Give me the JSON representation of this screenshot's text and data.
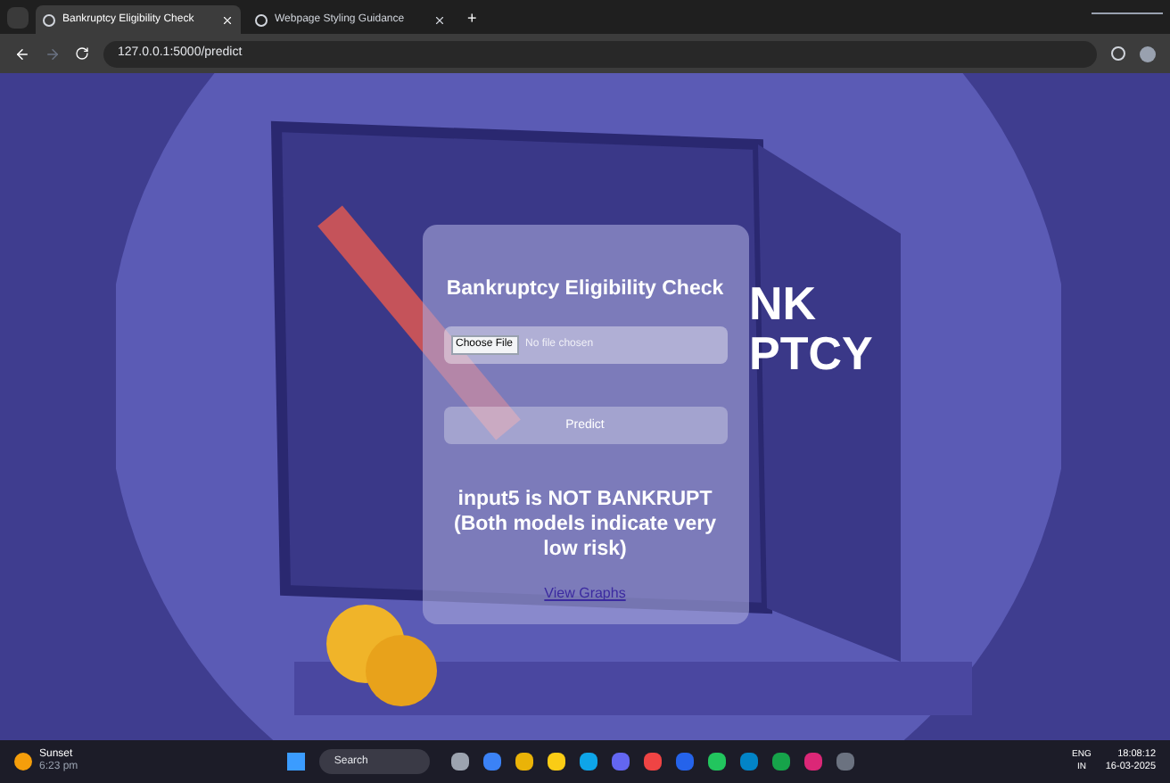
{
  "browser": {
    "tabs": [
      {
        "title": "Bankruptcy Eligibility Check",
        "selected": true
      },
      {
        "title": "Webpage Styling Guidance",
        "selected": false
      }
    ],
    "new_tab": "+",
    "address": "127.0.0.1:5000/predict"
  },
  "illustration": {
    "sign_lines": [
      "NK",
      "PTCY"
    ]
  },
  "card": {
    "title": "Bankruptcy Eligibility Check",
    "file_button": "Choose File",
    "file_status": "No file chosen",
    "predict_button": "Predict",
    "result": "input5 is NOT BANKRUPT (Both models indicate very low risk)",
    "link": "View Graphs"
  },
  "taskbar": {
    "weather": {
      "title": "Sunset",
      "time": "6:23 pm"
    },
    "search": "Search",
    "apps": [
      {
        "color": "#9ca3af"
      },
      {
        "color": "#3b82f6"
      },
      {
        "color": "#eab308"
      },
      {
        "color": "#facc15"
      },
      {
        "color": "#0ea5e9"
      },
      {
        "color": "#6366f1"
      },
      {
        "color": "#ef4444"
      },
      {
        "color": "#2563eb"
      },
      {
        "color": "#22c55e"
      },
      {
        "color": "#0284c7"
      },
      {
        "color": "#16a34a"
      },
      {
        "color": "#db2777"
      },
      {
        "color": "#6b7280"
      }
    ],
    "tray": {
      "lang": "ENG",
      "region": "IN",
      "clock": "18:08:12",
      "date": "16-03-2025"
    }
  }
}
